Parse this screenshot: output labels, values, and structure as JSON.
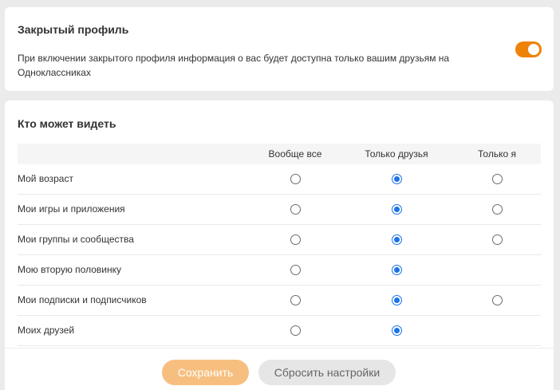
{
  "private_profile": {
    "title": "Закрытый профиль",
    "description": "При включении закрытого профиля информация о вас будет доступна только вашим друзьям на Одноклассниках",
    "toggle_on": true,
    "toggle_color": "#ee8208"
  },
  "visibility": {
    "title": "Кто может видеть",
    "columns": [
      "Вообще все",
      "Только друзья",
      "Только я"
    ],
    "rows": [
      {
        "label": "Мой возраст",
        "selected": 1,
        "has_only_me": true
      },
      {
        "label": "Мои игры и приложения",
        "selected": 1,
        "has_only_me": true
      },
      {
        "label": "Мои группы и сообщества",
        "selected": 1,
        "has_only_me": true
      },
      {
        "label": "Мою вторую половинку",
        "selected": 1,
        "has_only_me": false
      },
      {
        "label": "Мои подписки и подписчиков",
        "selected": 1,
        "has_only_me": true
      },
      {
        "label": "Моих друзей",
        "selected": 1,
        "has_only_me": false
      }
    ]
  },
  "footer": {
    "save_label": "Сохранить",
    "reset_label": "Сбросить настройки"
  },
  "colors": {
    "accent": "#ee8208",
    "radio_checked": "#1a73e8",
    "save_button": "#f7bf7f"
  }
}
